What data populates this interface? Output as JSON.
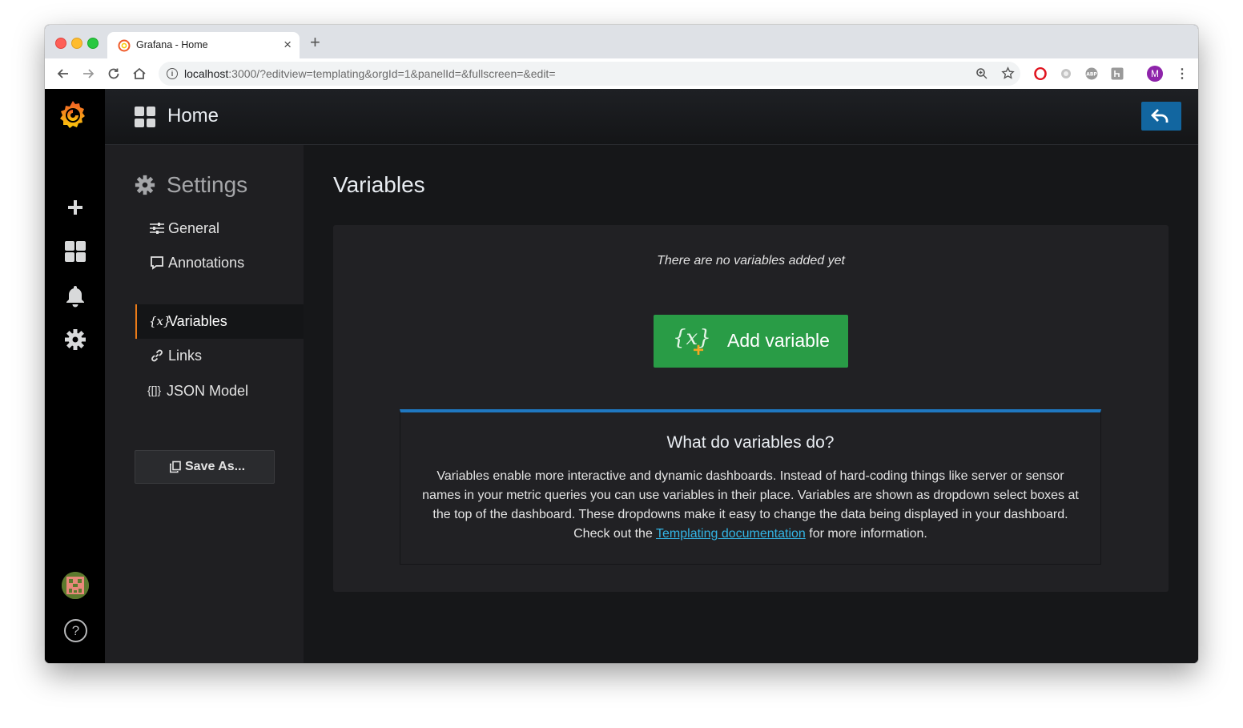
{
  "browser": {
    "tab_title": "Grafana - Home",
    "tab_close": "×",
    "new_tab": "+",
    "url_host": "localhost",
    "url_rest": ":3000/?editview=templating&orgId=1&panelId=&fullscreen=&edit=",
    "profile_initial": "M"
  },
  "header": {
    "title": "Home"
  },
  "settings_nav": {
    "title": "Settings",
    "items": [
      {
        "label": "General",
        "icon": "sliders-icon"
      },
      {
        "label": "Annotations",
        "icon": "comment-icon"
      },
      {
        "label": "Variables",
        "icon": "variable-icon",
        "icon_text": "{x}",
        "active": true
      },
      {
        "label": "Links",
        "icon": "link-icon"
      },
      {
        "label": "JSON Model",
        "icon": "json-icon",
        "icon_text": "{[]}"
      }
    ],
    "save_as_label": "Save As..."
  },
  "main": {
    "heading": "Variables",
    "empty_text": "There are no variables added yet",
    "add_button_label": "Add variable",
    "info": {
      "title": "What do variables do?",
      "body": "Variables enable more interactive and dynamic dashboards. Instead of hard-coding things like server or sensor names in your metric queries you can use variables in their place. Variables are shown as dropdown select boxes at the top of the dashboard. These dropdowns make it easy to change the data being displayed in your dashboard. Check out the",
      "link_text": "Templating documentation",
      "body_end": " for more information."
    }
  },
  "colors": {
    "accent_active": "#eb7b18",
    "primary_button": "#299c46",
    "back_button": "#1266a0",
    "info_border": "#1f78c1",
    "link": "#33b5e5"
  }
}
